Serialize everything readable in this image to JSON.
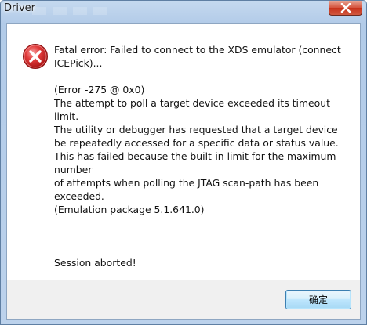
{
  "window": {
    "title": "Driver"
  },
  "icons": {
    "error": "error-icon",
    "close": "close-icon"
  },
  "message": {
    "line_1": "Fatal error: Failed to connect to the XDS emulator (connect ICEPick)...",
    "line_2": "(Error -275 @ 0x0)",
    "line_3": "The attempt to poll a target device exceeded its timeout limit.",
    "line_4": "The utility or debugger has requested that a target device be repeatedly accessed for a specific data or status value.",
    "line_5": "This has failed because the built-in limit for the maximum number",
    "line_6": "of attempts when polling the JTAG scan-path has been exceeded.",
    "line_7": "(Emulation package 5.1.641.0)",
    "line_8": "Session aborted!"
  },
  "buttons": {
    "ok_label": "确定"
  },
  "colors": {
    "error_red": "#d42f2f",
    "close_red": "#c7321b",
    "button_border": "#3c7fb1"
  }
}
